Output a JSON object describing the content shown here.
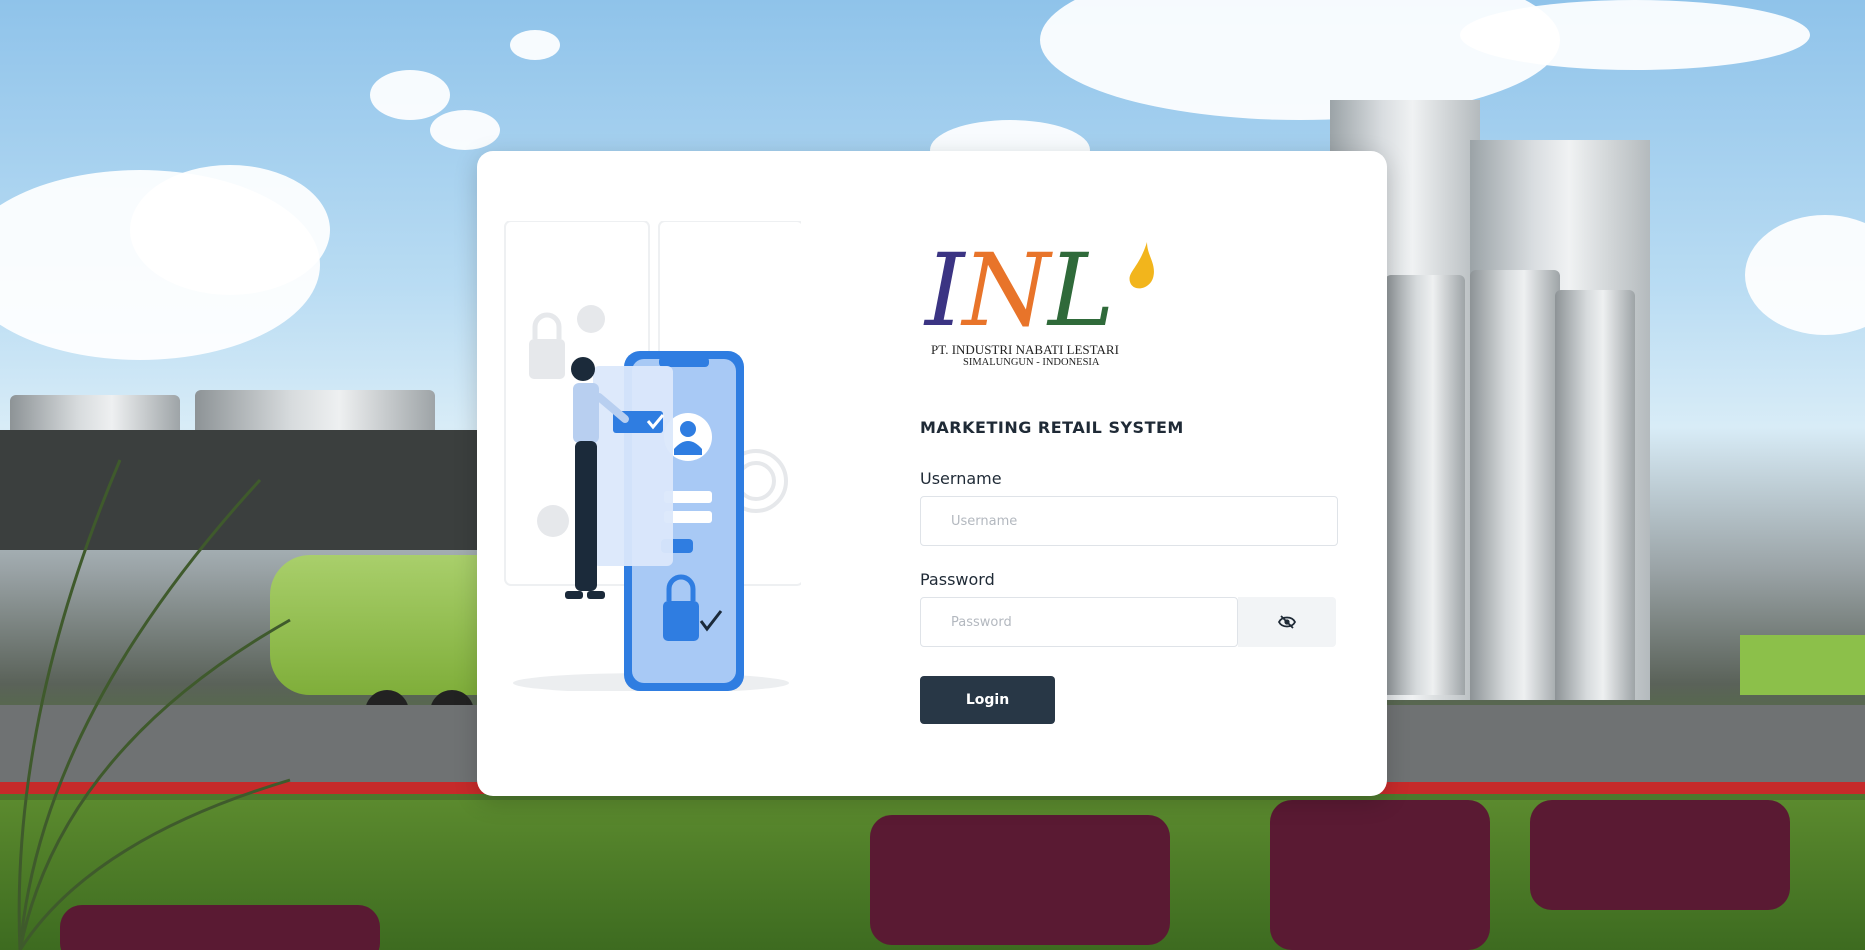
{
  "company": {
    "logo_text_i": "I",
    "logo_text_n": "N",
    "logo_text_l": "L",
    "name": "PT. INDUSTRI NABATI LESTARI",
    "location": "SIMALUNGUN - INDONESIA"
  },
  "login": {
    "system_title": "MARKETING RETAIL SYSTEM",
    "username_label": "Username",
    "username_placeholder": "Username",
    "username_value": "",
    "password_label": "Password",
    "password_placeholder": "Password",
    "password_value": "",
    "toggle_icon": "eye-slash-icon",
    "login_label": "Login"
  },
  "colors": {
    "button_bg": "#283746",
    "logo_i": "#3b3483",
    "logo_n": "#e8742a",
    "logo_l": "#2f6a3a",
    "logo_drop": "#f2b51c"
  }
}
